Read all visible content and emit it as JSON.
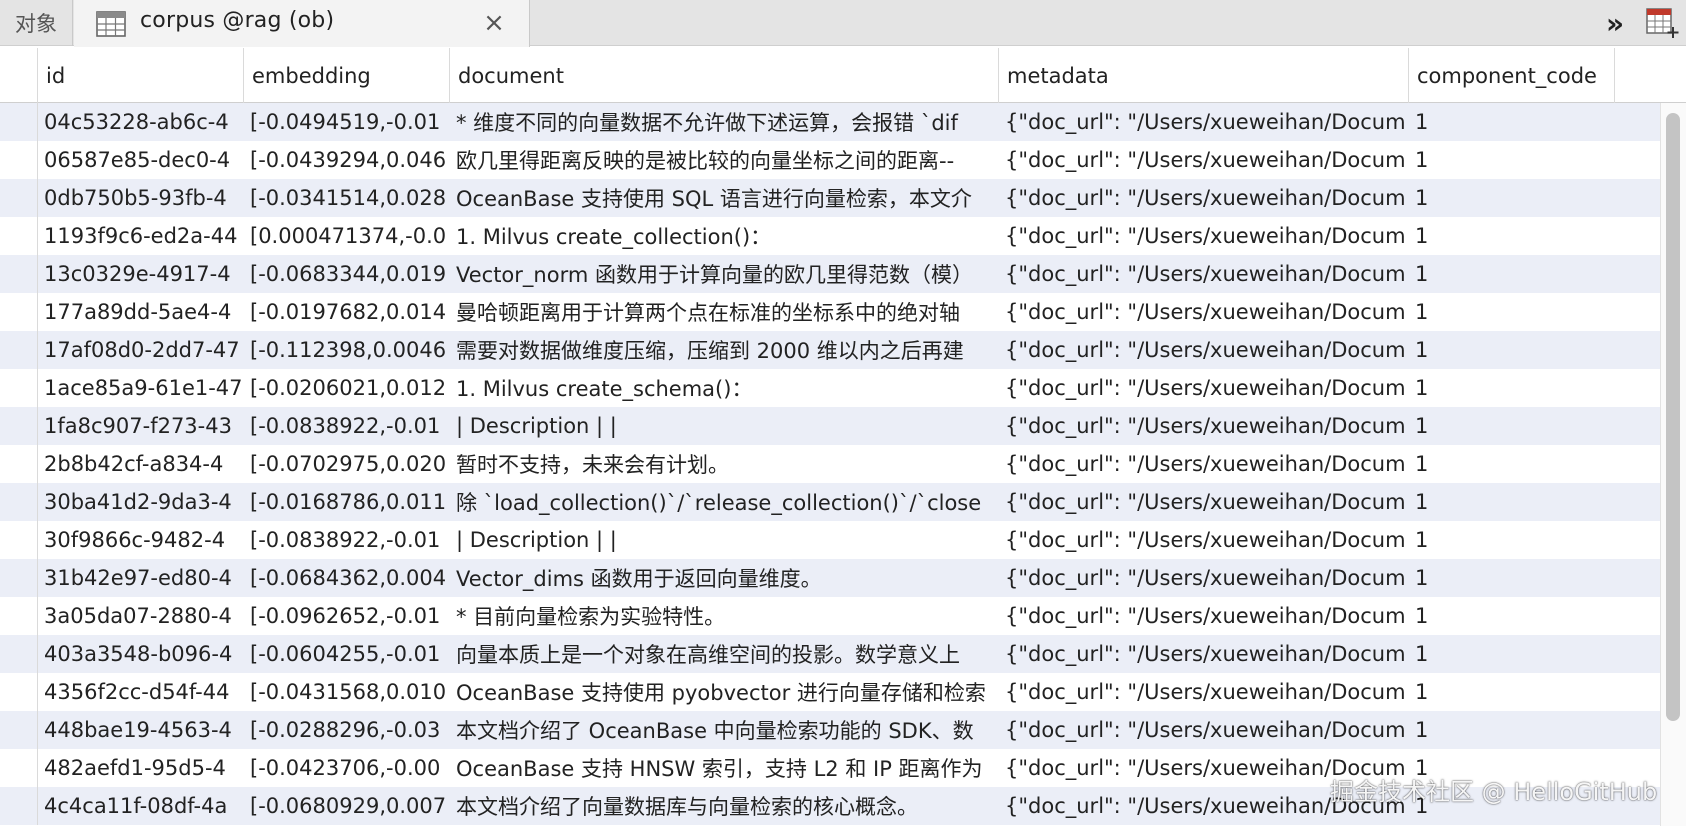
{
  "tabbar": {
    "objects_tab": "对象",
    "active_tab_title": "corpus @rag (ob)",
    "active_tab_icon": "table-icon",
    "close_icon": "close-icon",
    "more_icon": "double-chevron-right-icon",
    "new_table_icon": "table-add-icon"
  },
  "grid": {
    "columns": [
      "id",
      "embedding",
      "document",
      "metadata",
      "component_code"
    ],
    "rows": [
      [
        "04c53228-ab6c-4",
        "[-0.0494519,-0.01",
        "* 维度不同的向量数据不允许做下述运算，会报错 `dif",
        "{\"doc_url\": \"/Users/xueweihan/Docum",
        "1"
      ],
      [
        "06587e85-dec0-4",
        "[-0.0439294,0.046",
        "欧几里得距离反映的是被比较的向量坐标之间的距离--",
        "{\"doc_url\": \"/Users/xueweihan/Docum",
        "1"
      ],
      [
        "0db750b5-93fb-4",
        "[-0.0341514,0.028",
        "OceanBase 支持使用 SQL 语言进行向量检索，本文介",
        "{\"doc_url\": \"/Users/xueweihan/Docum",
        "1"
      ],
      [
        "1193f9c6-ed2a-44",
        "[0.000471374,-0.0",
        "1. Milvus create_collection()：",
        "{\"doc_url\": \"/Users/xueweihan/Docum",
        "1"
      ],
      [
        "13c0329e-4917-4",
        "[-0.0683344,0.019",
        "Vector_norm 函数用于计算向量的欧几里得范数（模）",
        "{\"doc_url\": \"/Users/xueweihan/Docum",
        "1"
      ],
      [
        "177a89dd-5ae4-4",
        "[-0.0197682,0.014",
        "曼哈顿距离用于计算两个点在标准的坐标系中的绝对轴",
        "{\"doc_url\": \"/Users/xueweihan/Docum",
        "1"
      ],
      [
        "17af08d0-2dd7-47",
        "[-0.112398,0.0046",
        "需要对数据做维度压缩，压缩到 2000 维以内之后再建",
        "{\"doc_url\": \"/Users/xueweihan/Docum",
        "1"
      ],
      [
        "1ace85a9-61e1-47",
        "[-0.0206021,0.012",
        "1. Milvus create_schema()：",
        "{\"doc_url\": \"/Users/xueweihan/Docum",
        "1"
      ],
      [
        "1fa8c907-f273-43",
        "[-0.0838922,-0.01",
        "| Description   |               |",
        "{\"doc_url\": \"/Users/xueweihan/Docum",
        "1"
      ],
      [
        "2b8b42cf-a834-4",
        "[-0.0702975,0.020",
        "暂时不支持，未来会有计划。",
        "{\"doc_url\": \"/Users/xueweihan/Docum",
        "1"
      ],
      [
        "30ba41d2-9da3-4",
        "[-0.0168786,0.011",
        "除 `load_collection()`/`release_collection()`/`close",
        "{\"doc_url\": \"/Users/xueweihan/Docum",
        "1"
      ],
      [
        "30f9866c-9482-4",
        "[-0.0838922,-0.01",
        "| Description   |               |",
        "{\"doc_url\": \"/Users/xueweihan/Docum",
        "1"
      ],
      [
        "31b42e97-ed80-4",
        "[-0.0684362,0.004",
        "Vector_dims 函数用于返回向量维度。",
        "{\"doc_url\": \"/Users/xueweihan/Docum",
        "1"
      ],
      [
        "3a05da07-2880-4",
        "[-0.0962652,-0.01",
        "* 目前向量检索为实验特性。",
        "{\"doc_url\": \"/Users/xueweihan/Docum",
        "1"
      ],
      [
        "403a3548-b096-4",
        "[-0.0604255,-0.01",
        "向量本质上是一个对象在高维空间的投影。数学意义上",
        "{\"doc_url\": \"/Users/xueweihan/Docum",
        "1"
      ],
      [
        "4356f2cc-d54f-44",
        "[-0.0431568,0.010",
        "OceanBase 支持使用 pyobvector 进行向量存储和检索",
        "{\"doc_url\": \"/Users/xueweihan/Docum",
        "1"
      ],
      [
        "448bae19-4563-4",
        "[-0.0288296,-0.03",
        "本文档介绍了 OceanBase 中向量检索功能的 SDK、数",
        "{\"doc_url\": \"/Users/xueweihan/Docum",
        "1"
      ],
      [
        "482aefd1-95d5-4",
        "[-0.0423706,-0.00",
        "OceanBase 支持 HNSW 索引，支持 L2 和 IP 距离作为",
        "{\"doc_url\": \"/Users/xueweihan/Docum",
        "1"
      ],
      [
        "4c4ca11f-08df-4a",
        "[-0.0680929,0.007",
        "本文档介绍了向量数据库与向量检索的核心概念。",
        "{\"doc_url\": \"/Users/xueweihan/Docum",
        "1"
      ]
    ]
  },
  "watermark": "掘金技术社区 @ HelloGitHub"
}
